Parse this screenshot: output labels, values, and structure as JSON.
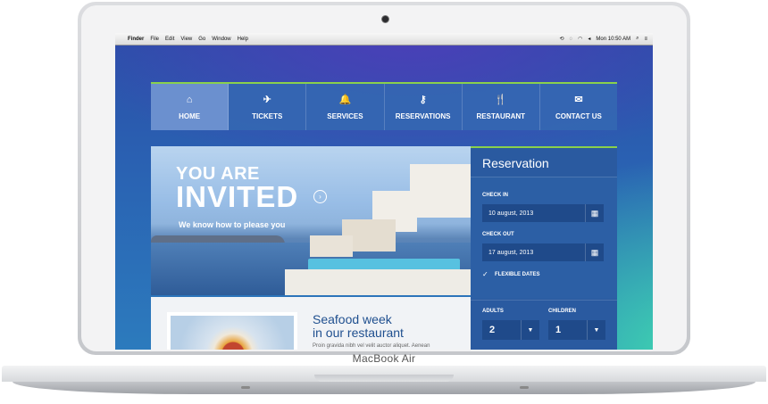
{
  "device": {
    "brand_label": "MacBook Air"
  },
  "menubar": {
    "apple_icon": "",
    "app_name": "Finder",
    "menus": [
      "File",
      "Edit",
      "View",
      "Go",
      "Window",
      "Help"
    ],
    "clock": "Mon 10:50 AM",
    "status_icons": [
      "time-machine-icon",
      "sync-icon",
      "wifi-icon",
      "volume-icon",
      "search-icon",
      "list-icon"
    ]
  },
  "nav": {
    "items": [
      {
        "label": "HOME",
        "icon": "home-icon",
        "glyph": "⌂",
        "active": true
      },
      {
        "label": "TICKETS",
        "icon": "plane-icon",
        "glyph": "✈",
        "active": false
      },
      {
        "label": "SERVICES",
        "icon": "bell-icon",
        "glyph": "🔔",
        "active": false
      },
      {
        "label": "RESERVATIONS",
        "icon": "key-icon",
        "glyph": "⚷",
        "active": false
      },
      {
        "label": "RESTAURANT",
        "icon": "fork-knife-icon",
        "glyph": "🍴",
        "active": false
      },
      {
        "label": "CONTACT US",
        "icon": "envelope-icon",
        "glyph": "✉",
        "active": false
      }
    ],
    "accent_color": "#8ad04c"
  },
  "hero": {
    "line1": "YOU ARE",
    "line2": "INVITED",
    "subtitle": "We know how to please you",
    "arrow_glyph": "›"
  },
  "promo": {
    "title_line1": "Seafood week",
    "title_line2": "in our restaurant",
    "excerpt": "Proin gravida nibh vel velit auctor aliquet. Aenean"
  },
  "reservation": {
    "title": "Reservation",
    "check_in_label": "CHECK IN",
    "check_in_value": "10 august, 2013",
    "check_out_label": "CHECK OUT",
    "check_out_value": "17 august, 2013",
    "flexible_label": "FLEXIBLE DATES",
    "flexible_checked": true,
    "adults_label": "ADULTS",
    "adults_value": "2",
    "children_label": "CHILDREN",
    "children_value": "1",
    "calendar_glyph": "▦",
    "caret_glyph": "▼",
    "check_glyph": "✓"
  }
}
